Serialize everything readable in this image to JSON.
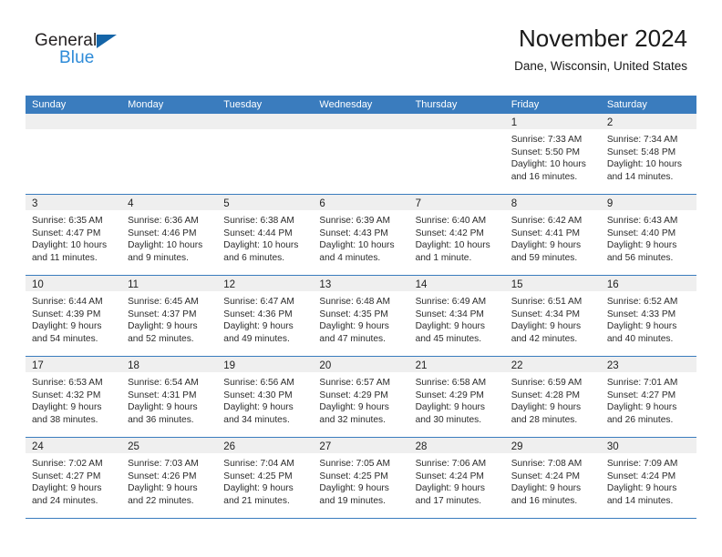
{
  "brand": {
    "name_part1": "General",
    "name_part2": "Blue",
    "accent_color": "#2e8bd8",
    "triangle_color": "#1565a8"
  },
  "header": {
    "title": "November 2024",
    "subtitle": "Dane, Wisconsin, United States",
    "header_bar_color": "#3a7cbe"
  },
  "weekdays": [
    "Sunday",
    "Monday",
    "Tuesday",
    "Wednesday",
    "Thursday",
    "Friday",
    "Saturday"
  ],
  "weeks": [
    [
      {
        "day": "",
        "empty": true
      },
      {
        "day": "",
        "empty": true
      },
      {
        "day": "",
        "empty": true
      },
      {
        "day": "",
        "empty": true
      },
      {
        "day": "",
        "empty": true
      },
      {
        "day": "1",
        "sunrise": "Sunrise: 7:33 AM",
        "sunset": "Sunset: 5:50 PM",
        "daylight1": "Daylight: 10 hours",
        "daylight2": "and 16 minutes."
      },
      {
        "day": "2",
        "sunrise": "Sunrise: 7:34 AM",
        "sunset": "Sunset: 5:48 PM",
        "daylight1": "Daylight: 10 hours",
        "daylight2": "and 14 minutes."
      }
    ],
    [
      {
        "day": "3",
        "sunrise": "Sunrise: 6:35 AM",
        "sunset": "Sunset: 4:47 PM",
        "daylight1": "Daylight: 10 hours",
        "daylight2": "and 11 minutes."
      },
      {
        "day": "4",
        "sunrise": "Sunrise: 6:36 AM",
        "sunset": "Sunset: 4:46 PM",
        "daylight1": "Daylight: 10 hours",
        "daylight2": "and 9 minutes."
      },
      {
        "day": "5",
        "sunrise": "Sunrise: 6:38 AM",
        "sunset": "Sunset: 4:44 PM",
        "daylight1": "Daylight: 10 hours",
        "daylight2": "and 6 minutes."
      },
      {
        "day": "6",
        "sunrise": "Sunrise: 6:39 AM",
        "sunset": "Sunset: 4:43 PM",
        "daylight1": "Daylight: 10 hours",
        "daylight2": "and 4 minutes."
      },
      {
        "day": "7",
        "sunrise": "Sunrise: 6:40 AM",
        "sunset": "Sunset: 4:42 PM",
        "daylight1": "Daylight: 10 hours",
        "daylight2": "and 1 minute."
      },
      {
        "day": "8",
        "sunrise": "Sunrise: 6:42 AM",
        "sunset": "Sunset: 4:41 PM",
        "daylight1": "Daylight: 9 hours",
        "daylight2": "and 59 minutes."
      },
      {
        "day": "9",
        "sunrise": "Sunrise: 6:43 AM",
        "sunset": "Sunset: 4:40 PM",
        "daylight1": "Daylight: 9 hours",
        "daylight2": "and 56 minutes."
      }
    ],
    [
      {
        "day": "10",
        "sunrise": "Sunrise: 6:44 AM",
        "sunset": "Sunset: 4:39 PM",
        "daylight1": "Daylight: 9 hours",
        "daylight2": "and 54 minutes."
      },
      {
        "day": "11",
        "sunrise": "Sunrise: 6:45 AM",
        "sunset": "Sunset: 4:37 PM",
        "daylight1": "Daylight: 9 hours",
        "daylight2": "and 52 minutes."
      },
      {
        "day": "12",
        "sunrise": "Sunrise: 6:47 AM",
        "sunset": "Sunset: 4:36 PM",
        "daylight1": "Daylight: 9 hours",
        "daylight2": "and 49 minutes."
      },
      {
        "day": "13",
        "sunrise": "Sunrise: 6:48 AM",
        "sunset": "Sunset: 4:35 PM",
        "daylight1": "Daylight: 9 hours",
        "daylight2": "and 47 minutes."
      },
      {
        "day": "14",
        "sunrise": "Sunrise: 6:49 AM",
        "sunset": "Sunset: 4:34 PM",
        "daylight1": "Daylight: 9 hours",
        "daylight2": "and 45 minutes."
      },
      {
        "day": "15",
        "sunrise": "Sunrise: 6:51 AM",
        "sunset": "Sunset: 4:34 PM",
        "daylight1": "Daylight: 9 hours",
        "daylight2": "and 42 minutes."
      },
      {
        "day": "16",
        "sunrise": "Sunrise: 6:52 AM",
        "sunset": "Sunset: 4:33 PM",
        "daylight1": "Daylight: 9 hours",
        "daylight2": "and 40 minutes."
      }
    ],
    [
      {
        "day": "17",
        "sunrise": "Sunrise: 6:53 AM",
        "sunset": "Sunset: 4:32 PM",
        "daylight1": "Daylight: 9 hours",
        "daylight2": "and 38 minutes."
      },
      {
        "day": "18",
        "sunrise": "Sunrise: 6:54 AM",
        "sunset": "Sunset: 4:31 PM",
        "daylight1": "Daylight: 9 hours",
        "daylight2": "and 36 minutes."
      },
      {
        "day": "19",
        "sunrise": "Sunrise: 6:56 AM",
        "sunset": "Sunset: 4:30 PM",
        "daylight1": "Daylight: 9 hours",
        "daylight2": "and 34 minutes."
      },
      {
        "day": "20",
        "sunrise": "Sunrise: 6:57 AM",
        "sunset": "Sunset: 4:29 PM",
        "daylight1": "Daylight: 9 hours",
        "daylight2": "and 32 minutes."
      },
      {
        "day": "21",
        "sunrise": "Sunrise: 6:58 AM",
        "sunset": "Sunset: 4:29 PM",
        "daylight1": "Daylight: 9 hours",
        "daylight2": "and 30 minutes."
      },
      {
        "day": "22",
        "sunrise": "Sunrise: 6:59 AM",
        "sunset": "Sunset: 4:28 PM",
        "daylight1": "Daylight: 9 hours",
        "daylight2": "and 28 minutes."
      },
      {
        "day": "23",
        "sunrise": "Sunrise: 7:01 AM",
        "sunset": "Sunset: 4:27 PM",
        "daylight1": "Daylight: 9 hours",
        "daylight2": "and 26 minutes."
      }
    ],
    [
      {
        "day": "24",
        "sunrise": "Sunrise: 7:02 AM",
        "sunset": "Sunset: 4:27 PM",
        "daylight1": "Daylight: 9 hours",
        "daylight2": "and 24 minutes."
      },
      {
        "day": "25",
        "sunrise": "Sunrise: 7:03 AM",
        "sunset": "Sunset: 4:26 PM",
        "daylight1": "Daylight: 9 hours",
        "daylight2": "and 22 minutes."
      },
      {
        "day": "26",
        "sunrise": "Sunrise: 7:04 AM",
        "sunset": "Sunset: 4:25 PM",
        "daylight1": "Daylight: 9 hours",
        "daylight2": "and 21 minutes."
      },
      {
        "day": "27",
        "sunrise": "Sunrise: 7:05 AM",
        "sunset": "Sunset: 4:25 PM",
        "daylight1": "Daylight: 9 hours",
        "daylight2": "and 19 minutes."
      },
      {
        "day": "28",
        "sunrise": "Sunrise: 7:06 AM",
        "sunset": "Sunset: 4:24 PM",
        "daylight1": "Daylight: 9 hours",
        "daylight2": "and 17 minutes."
      },
      {
        "day": "29",
        "sunrise": "Sunrise: 7:08 AM",
        "sunset": "Sunset: 4:24 PM",
        "daylight1": "Daylight: 9 hours",
        "daylight2": "and 16 minutes."
      },
      {
        "day": "30",
        "sunrise": "Sunrise: 7:09 AM",
        "sunset": "Sunset: 4:24 PM",
        "daylight1": "Daylight: 9 hours",
        "daylight2": "and 14 minutes."
      }
    ]
  ]
}
